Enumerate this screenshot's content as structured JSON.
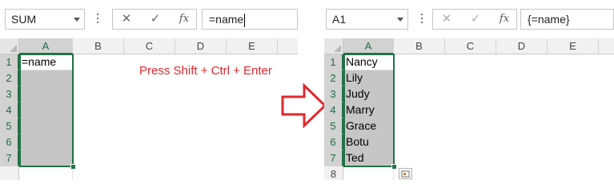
{
  "left": {
    "name_box": "SUM",
    "formula_buttons": {
      "cancel": "✕",
      "enter": "✓",
      "function": "fx"
    },
    "formula": "=name",
    "columns": [
      "A",
      "B",
      "C",
      "D",
      "E"
    ],
    "rows": [
      "1",
      "2",
      "3",
      "4",
      "5",
      "6",
      "7"
    ],
    "cell_a1": "=name",
    "instruction": "Press Shift + Ctrl + Enter"
  },
  "right": {
    "name_box": "A1",
    "formula_buttons": {
      "cancel": "✕",
      "enter": "✓",
      "function": "fx"
    },
    "formula": "{=name}",
    "columns": [
      "A",
      "B",
      "C",
      "D",
      "E"
    ],
    "rows": [
      "1",
      "2",
      "3",
      "4",
      "5",
      "6",
      "7",
      "8"
    ],
    "values": [
      "Nancy",
      "Lily",
      "Judy",
      "Marry",
      "Grace",
      "Botu",
      "Ted"
    ]
  },
  "icons": {
    "arrow": "right-arrow-icon",
    "quick_analysis": "quick-analysis-icon",
    "arrow_color": "#e0282e"
  },
  "colors": {
    "selection": "#217346",
    "highlight": "#c6c6c6",
    "text_red": "#e0282e"
  }
}
